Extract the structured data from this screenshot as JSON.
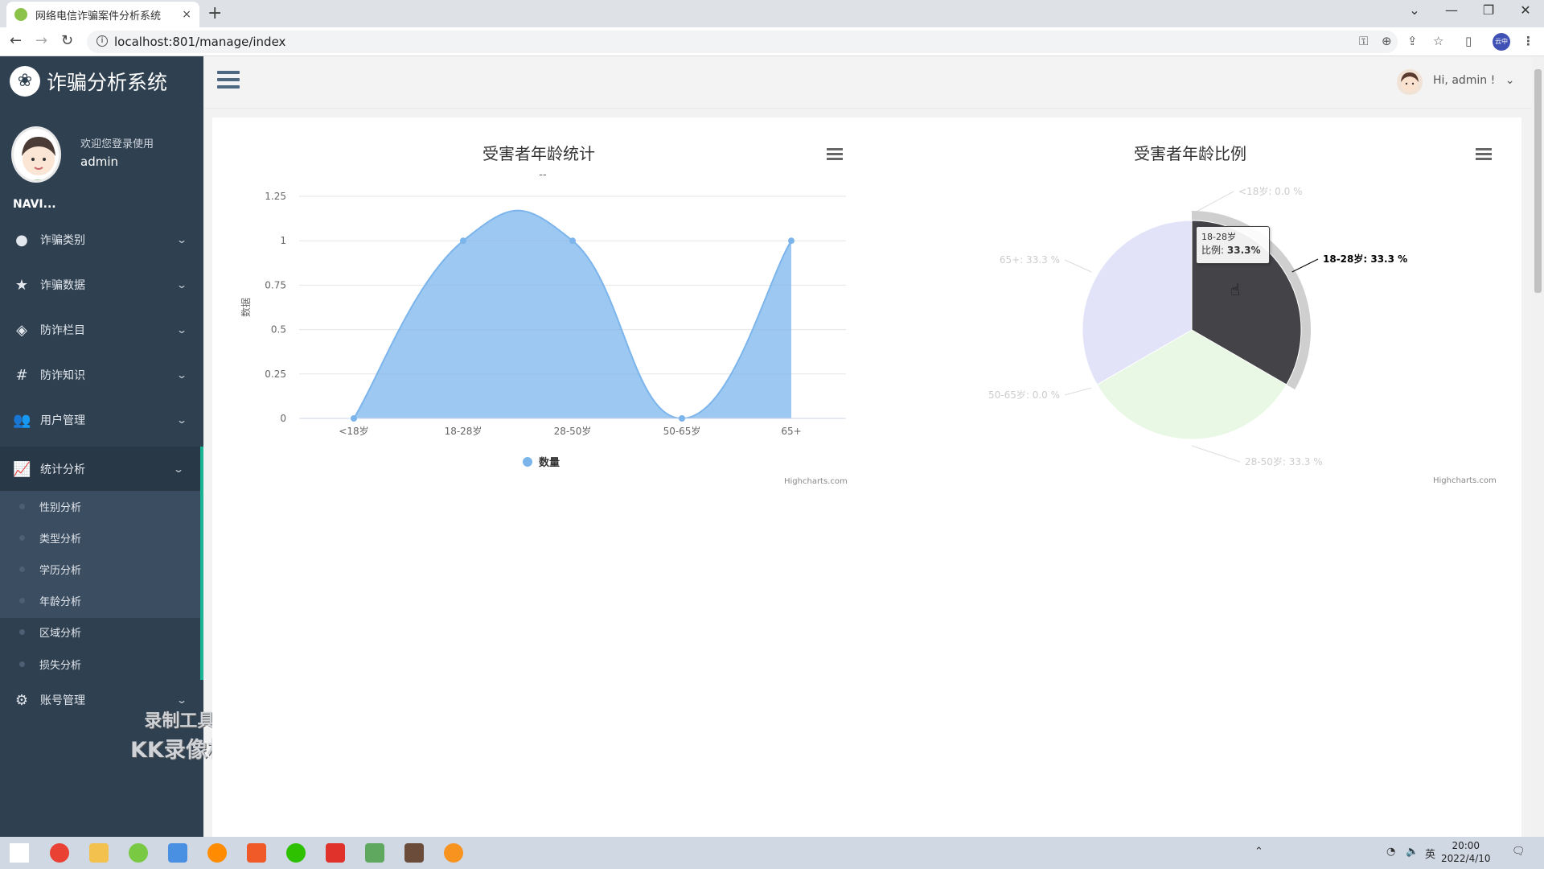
{
  "browser": {
    "tab_title": "网络电信诈骗案件分析系统",
    "tab_close": "×",
    "new_tab": "+",
    "url": "localhost:801/manage/index",
    "profile_label": "云中"
  },
  "app": {
    "brand": "诈骗分析系统",
    "welcome": "欢迎您登录使用",
    "username": "admin",
    "navi_label": "NAVI...",
    "greeting": "Hi,  admin !",
    "menu": [
      {
        "label": "诈骗类别",
        "icon": "circle-icon"
      },
      {
        "label": "诈骗数据",
        "icon": "star-icon"
      },
      {
        "label": "防诈栏目",
        "icon": "cube-icon"
      },
      {
        "label": "防诈知识",
        "icon": "hashtag-icon"
      },
      {
        "label": "用户管理",
        "icon": "users-icon"
      },
      {
        "label": "统计分析",
        "icon": "line-chart-icon"
      },
      {
        "label": "账号管理",
        "icon": "gear-icon"
      }
    ],
    "submenu": [
      "性别分析",
      "类型分析",
      "学历分析",
      "年龄分析",
      "区域分析",
      "损失分析"
    ],
    "watermark_line1": "录制工具",
    "watermark_line2": "KK录像机"
  },
  "taskbar": {
    "time": "20:00",
    "date": "2022/4/10",
    "ime": "英"
  },
  "chart_data": [
    {
      "type": "area",
      "title": "受害者年龄统计",
      "subtitle": "--",
      "ylabel": "数据",
      "categories": [
        "<18岁",
        "18-28岁",
        "28-50岁",
        "50-65岁",
        "65+"
      ],
      "series": [
        {
          "name": "数量",
          "values": [
            0,
            1,
            1,
            0,
            1
          ],
          "color": "#7cb5ec"
        }
      ],
      "yticks": [
        "0",
        "0.25",
        "0.5",
        "0.75",
        "1",
        "1.25"
      ],
      "ylim": [
        0,
        1.25
      ],
      "grid": true,
      "legend": "bottom-center",
      "credit": "Highcharts.com"
    },
    {
      "type": "pie",
      "title": "受害者年龄比例",
      "slices": [
        {
          "label": "<18岁",
          "value": 0.0,
          "display": "<18岁: 0.0 %",
          "color": "#434348"
        },
        {
          "label": "18-28岁",
          "value": 33.3,
          "display": "18-28岁: 33.3 %",
          "color": "#434348"
        },
        {
          "label": "28-50岁",
          "value": 33.3,
          "display": "28-50岁: 33.3 %",
          "color": "#90ed7d"
        },
        {
          "label": "50-65岁",
          "value": 0.0,
          "display": "50-65岁: 0.0 %",
          "color": "#f7a35c"
        },
        {
          "label": "65+",
          "value": 33.3,
          "display": "65+: 33.3 %",
          "color": "#8085e9"
        }
      ],
      "tooltip": {
        "title": "18-28岁",
        "label": "比例:",
        "value": "33.3%"
      },
      "credit": "Highcharts.com"
    }
  ]
}
